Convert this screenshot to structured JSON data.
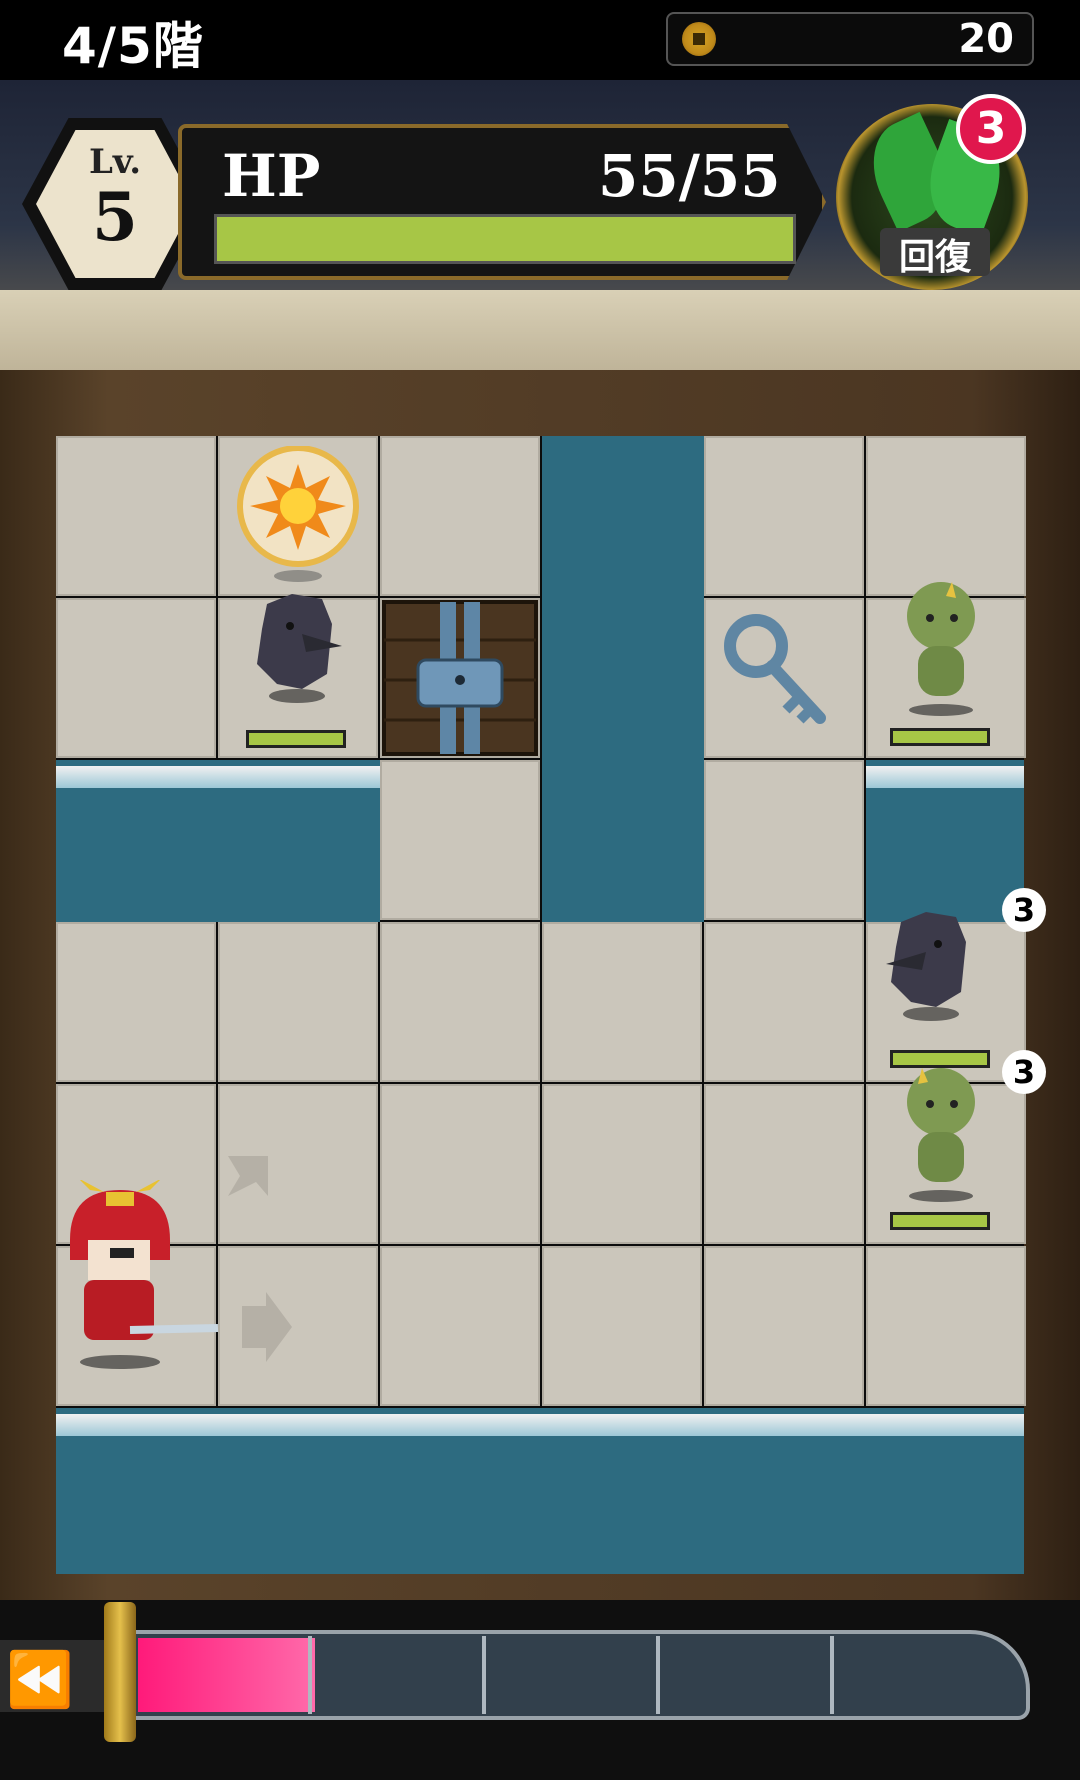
{
  "header": {
    "floor_label": "4/5階",
    "coins": "20",
    "level_label": "Lv.",
    "level_value": "5",
    "hp_label": "HP",
    "hp_text": "55/55",
    "hp_current": 55,
    "hp_max": 55,
    "heal_label": "回復",
    "heal_count": "3"
  },
  "colors": {
    "hp_bar": "#a7c646",
    "water": "#2d6b80",
    "gauge_fill": "#ff1a7a",
    "heal_badge": "#e0174d"
  },
  "board": {
    "columns": 6,
    "rows": 7,
    "entities": [
      {
        "type": "bomb-orb",
        "col": 2,
        "row": 1
      },
      {
        "type": "crow-enemy",
        "col": 2,
        "row": 2
      },
      {
        "type": "locked-gate",
        "col": 3,
        "row": 2
      },
      {
        "type": "key-item",
        "col": 5,
        "row": 2
      },
      {
        "type": "goblin-enemy",
        "col": 6,
        "row": 2
      },
      {
        "type": "crow-enemy",
        "col": 6,
        "row": 4,
        "counter": "3"
      },
      {
        "type": "goblin-enemy",
        "col": 6,
        "row": 5,
        "counter": "3"
      },
      {
        "type": "samurai-player",
        "col": 1,
        "row": 6
      }
    ]
  },
  "gauge": {
    "segments": 5,
    "fill_fraction": 0.2,
    "rewind_icon": "rewind-icon"
  }
}
